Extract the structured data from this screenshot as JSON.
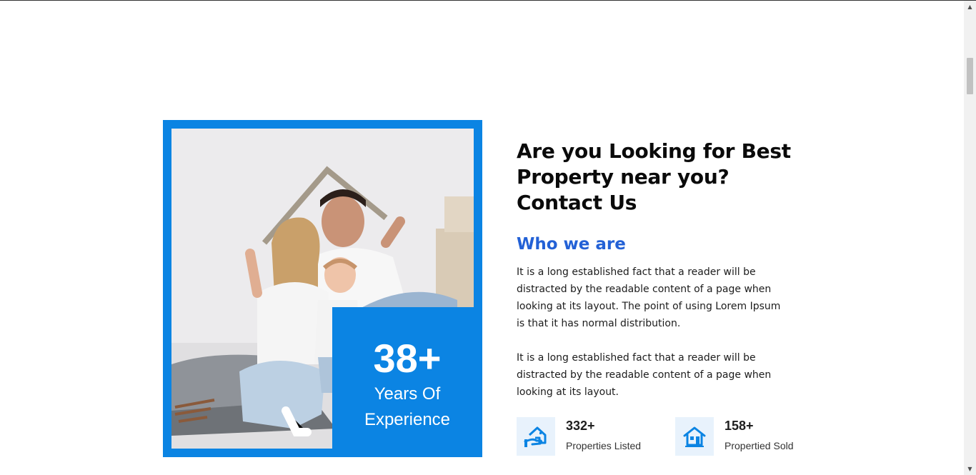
{
  "experience": {
    "number": "38+",
    "label": "Years Of Experience"
  },
  "about": {
    "headline": "Are you Looking for Best Property near you? Contact Us",
    "subheading": "Who we are",
    "paragraphs": [
      "It is a long established fact that a reader will be distracted by the readable content of a page when looking at its layout. The point of using Lorem Ipsum is that it has normal distribution.",
      "It is a long established fact that a reader will be distracted by the readable content of a page when looking at its layout."
    ]
  },
  "stats": [
    {
      "value": "332+",
      "label": "Properties Listed",
      "icon": "house-hand-icon"
    },
    {
      "value": "158+",
      "label": "Propertied Sold",
      "icon": "house-icon"
    }
  ],
  "colors": {
    "brand_blue": "#0b84e3",
    "subheading_blue": "#2361d6",
    "icon_bg": "#e8f2fc"
  }
}
